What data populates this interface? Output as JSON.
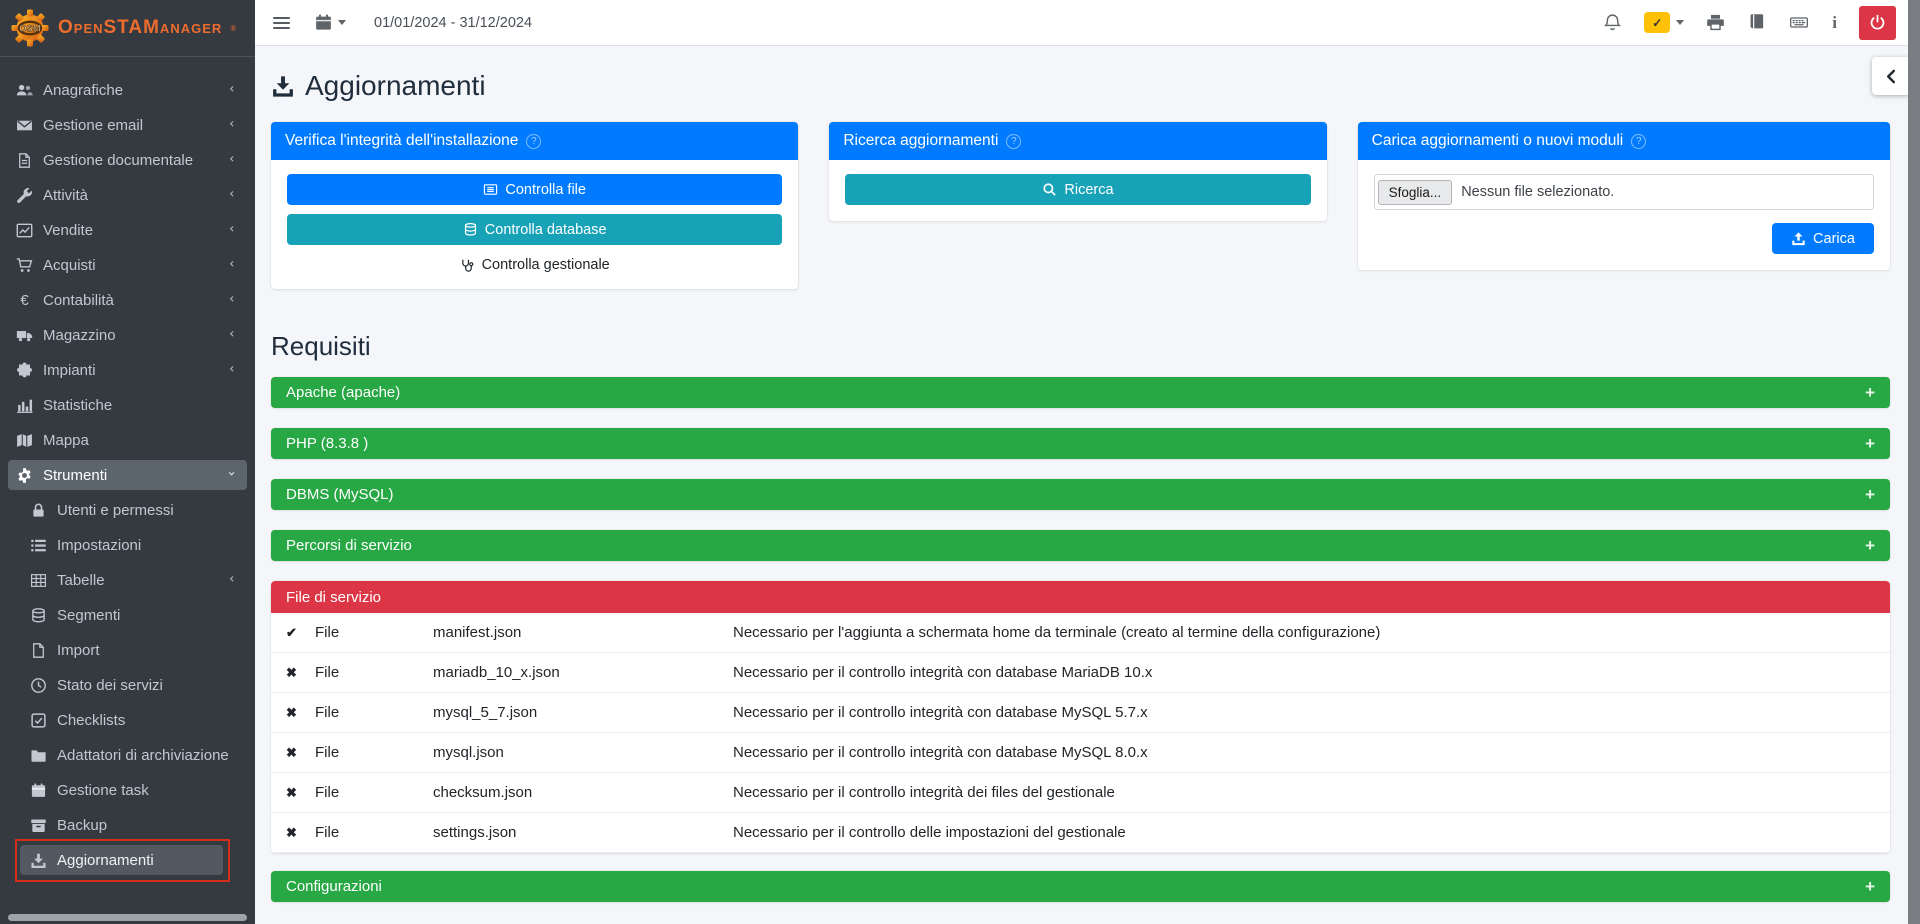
{
  "colors": {
    "accent": "#007bff",
    "teal": "#17a2b8",
    "green": "#28a745",
    "red": "#dc3545",
    "warning": "#ffc107",
    "sidebar": "#343a40",
    "highlight": "#d62c1a"
  },
  "brand": {
    "logo": "OSM",
    "name": "OpenSTAManager",
    "registered": "®"
  },
  "topbar": {
    "date_range": "01/01/2024 - 31/12/2024"
  },
  "page": {
    "title": "Aggiornamenti"
  },
  "sidebar": {
    "items": [
      {
        "icon": "users",
        "label": "Anagrafiche",
        "chevron": "left"
      },
      {
        "icon": "envelope",
        "label": "Gestione email",
        "chevron": "left"
      },
      {
        "icon": "file-alt",
        "label": "Gestione documentale",
        "chevron": "left"
      },
      {
        "icon": "wrench",
        "label": "Attività",
        "chevron": "left"
      },
      {
        "icon": "chart-line",
        "label": "Vendite",
        "chevron": "left"
      },
      {
        "icon": "cart",
        "label": "Acquisti",
        "chevron": "left"
      },
      {
        "icon": "euro",
        "label": "Contabilità",
        "chevron": "left"
      },
      {
        "icon": "truck",
        "label": "Magazzino",
        "chevron": "left"
      },
      {
        "icon": "puzzle",
        "label": "Impianti",
        "chevron": "left"
      },
      {
        "icon": "bar-chart",
        "label": "Statistiche"
      },
      {
        "icon": "map",
        "label": "Mappa"
      },
      {
        "icon": "gear",
        "label": "Strumenti",
        "chevron": "down",
        "active": true
      },
      {
        "icon": "lock",
        "label": "Utenti e permessi",
        "sub": true
      },
      {
        "icon": "list",
        "label": "Impostazioni",
        "sub": true
      },
      {
        "icon": "table",
        "label": "Tabelle",
        "sub": true,
        "chevron": "left"
      },
      {
        "icon": "database",
        "label": "Segmenti",
        "sub": true
      },
      {
        "icon": "file",
        "label": "Import",
        "sub": true
      },
      {
        "icon": "clock",
        "label": "Stato dei servizi",
        "sub": true
      },
      {
        "icon": "check-square",
        "label": "Checklists",
        "sub": true
      },
      {
        "icon": "folder",
        "label": "Adattatori di archiviazione",
        "sub": true
      },
      {
        "icon": "calendar",
        "label": "Gestione task",
        "sub": true
      },
      {
        "icon": "archive",
        "label": "Backup",
        "sub": true
      },
      {
        "icon": "download",
        "label": "Aggiornamenti",
        "sub": true,
        "selected": true
      }
    ]
  },
  "panels": {
    "verify": {
      "title": "Verifica l'integrità dell'installazione",
      "help": "?",
      "check_file": "Controlla file",
      "check_database": "Controlla database",
      "check_gestionale": "Controlla gestionale"
    },
    "search": {
      "title": "Ricerca aggiornamenti",
      "help": "?",
      "button": "Ricerca"
    },
    "upload": {
      "title": "Carica aggiornamenti o nuovi moduli",
      "help": "?",
      "browse": "Sfoglia...",
      "no_file": "Nessun file selezionato.",
      "button": "Carica"
    }
  },
  "requirements": {
    "heading": "Requisiti",
    "sections": [
      {
        "label": "Apache (apache)",
        "toggle": "+"
      },
      {
        "label": "PHP (8.3.8 )",
        "toggle": "+"
      },
      {
        "label": "DBMS (MySQL)",
        "toggle": "+"
      },
      {
        "label": "Percorsi di servizio",
        "toggle": "+"
      }
    ],
    "service_files": {
      "title": "File di servizio",
      "rows": [
        {
          "status": "ok",
          "type": "File",
          "name": "manifest.json",
          "description": "Necessario per l'aggiunta a schermata home da terminale (creato al termine della configurazione)"
        },
        {
          "status": "missing",
          "type": "File",
          "name": "mariadb_10_x.json",
          "description": "Necessario per il controllo integrità con database MariaDB 10.x"
        },
        {
          "status": "missing",
          "type": "File",
          "name": "mysql_5_7.json",
          "description": "Necessario per il controllo integrità con database MySQL 5.7.x"
        },
        {
          "status": "missing",
          "type": "File",
          "name": "mysql.json",
          "description": "Necessario per il controllo integrità con database MySQL 8.0.x"
        },
        {
          "status": "missing",
          "type": "File",
          "name": "checksum.json",
          "description": "Necessario per il controllo integrità dei files del gestionale"
        },
        {
          "status": "missing",
          "type": "File",
          "name": "settings.json",
          "description": "Necessario per il controllo delle impostazioni del gestionale"
        }
      ]
    },
    "configurations": {
      "label": "Configurazioni",
      "toggle": "+"
    }
  }
}
